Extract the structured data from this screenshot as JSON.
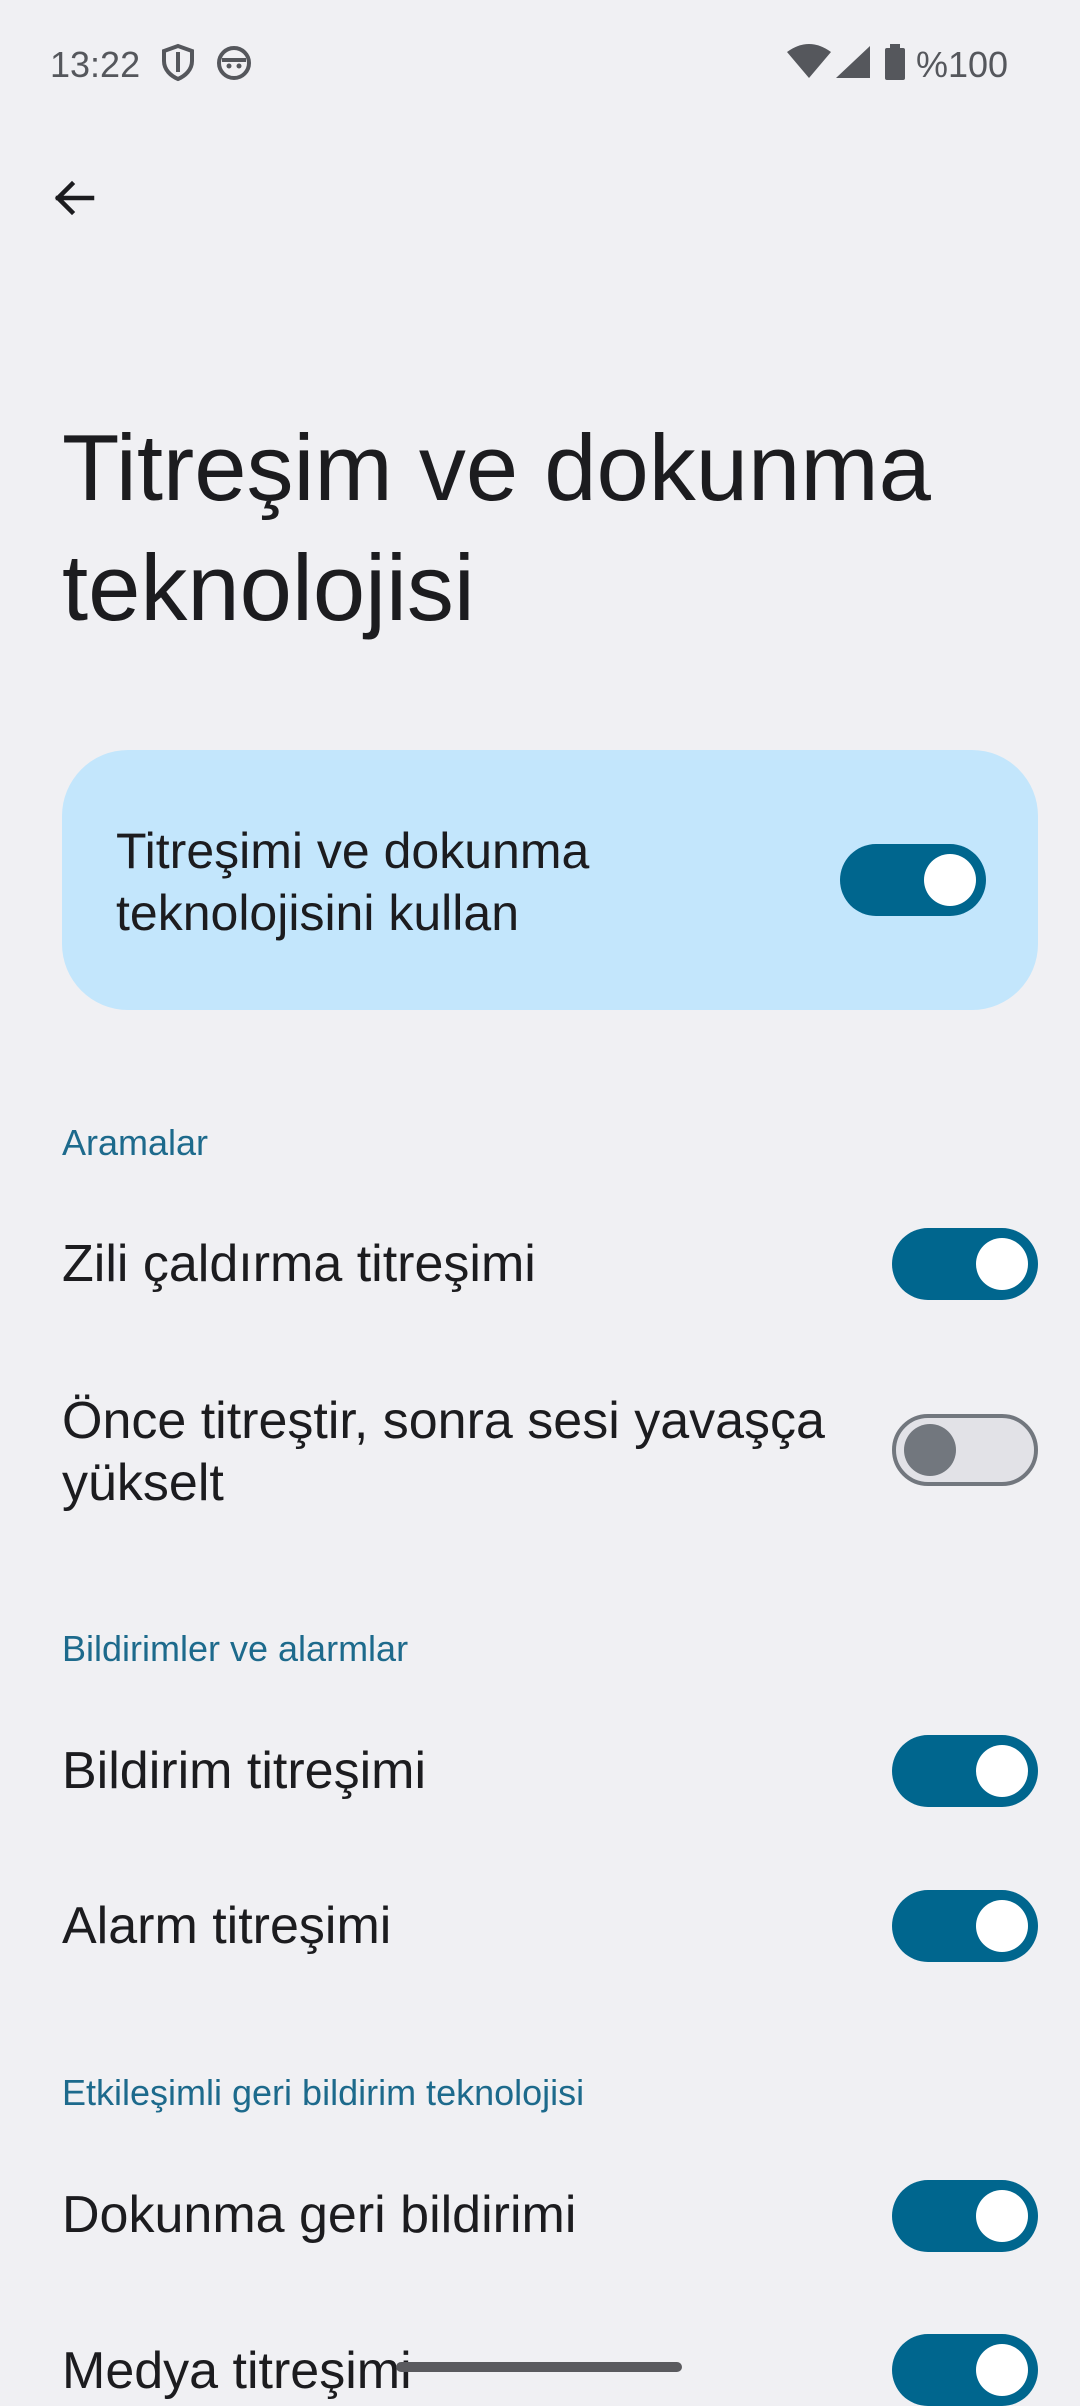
{
  "status_bar": {
    "time": "13:22",
    "battery_text": "%100",
    "icons": [
      "shield-icon",
      "android-face-icon",
      "wifi-icon",
      "cell-signal-icon",
      "battery-icon"
    ]
  },
  "header": {
    "back_icon": "arrow-back-icon",
    "title": "Titreşim ve dokunma teknolojisi"
  },
  "main_switch": {
    "label": "Titreşimi ve dokunma teknolojisini kullan",
    "state": "on"
  },
  "sections": [
    {
      "title": "Aramalar",
      "items": [
        {
          "label": "Zili çaldırma titreşimi",
          "state": "on"
        },
        {
          "label": "Önce titreştir, sonra sesi yavaşça yükselt",
          "state": "off"
        }
      ]
    },
    {
      "title": "Bildirimler ve alarmlar",
      "items": [
        {
          "label": "Bildirim titreşimi",
          "state": "on"
        },
        {
          "label": "Alarm titreşimi",
          "state": "on"
        }
      ]
    },
    {
      "title": "Etkileşimli geri bildirim teknolojisi",
      "items": [
        {
          "label": "Dokunma geri bildirimi",
          "state": "on"
        },
        {
          "label": "Medya titreşimi",
          "state": "on"
        }
      ]
    }
  ],
  "colors": {
    "background": "#f0f0f3",
    "card": "#c3e6fc",
    "toggle_on": "#00668e",
    "toggle_off_track": "#e2e2e7",
    "section_header": "#1d6a8c"
  }
}
